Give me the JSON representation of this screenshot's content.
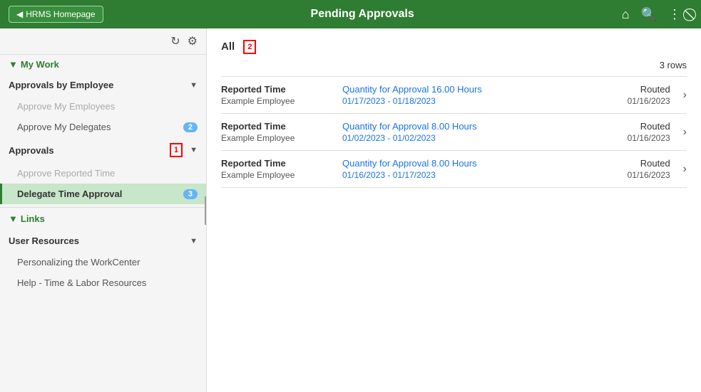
{
  "header": {
    "back_label": "HRMS Homepage",
    "title": "Pending Approvals",
    "icons": {
      "home": "⌂",
      "search": "🔍",
      "more": "⋮",
      "close": "⊘"
    }
  },
  "sidebar": {
    "icons": {
      "refresh": "↺",
      "settings": "⚙"
    },
    "my_work_label": "My Work",
    "sections": {
      "approvals_by_employee": {
        "label": "Approvals by Employee",
        "items": [
          {
            "label": "Approve My Employees",
            "disabled": true,
            "badge": null,
            "active": false
          },
          {
            "label": "Approve My Delegates",
            "disabled": false,
            "badge": "2",
            "active": false
          }
        ]
      },
      "approvals": {
        "label": "Approvals",
        "annotation": "1",
        "items": [
          {
            "label": "Approve Reported Time",
            "disabled": true,
            "badge": null,
            "active": false
          },
          {
            "label": "Delegate Time Approval",
            "disabled": false,
            "badge": "3",
            "active": true
          }
        ]
      }
    },
    "links_label": "Links",
    "user_resources": {
      "label": "User Resources",
      "items": [
        {
          "label": "Personalizing the WorkCenter",
          "disabled": false
        },
        {
          "label": "Help - Time & Labor Resources",
          "disabled": false
        }
      ]
    }
  },
  "main": {
    "section_title": "All",
    "annotation": "2",
    "rows_count": "3 rows",
    "rows": [
      {
        "type": "Reported Time",
        "employee": "Example Employee",
        "quantity_label": "Quantity for Approval",
        "quantity_value": "16.00 Hours",
        "date_range": "01/17/2023 - 01/18/2023",
        "status": "Routed",
        "status_date": "01/16/2023"
      },
      {
        "type": "Reported Time",
        "employee": "Example Employee",
        "quantity_label": "Quantity for Approval",
        "quantity_value": "8.00 Hours",
        "date_range": "01/02/2023 - 01/02/2023",
        "status": "Routed",
        "status_date": "01/16/2023"
      },
      {
        "type": "Reported Time",
        "employee": "Example Employee",
        "quantity_label": "Quantity for Approval",
        "quantity_value": "8.00 Hours",
        "date_range": "01/16/2023 - 01/17/2023",
        "status": "Routed",
        "status_date": "01/16/2023"
      }
    ]
  }
}
